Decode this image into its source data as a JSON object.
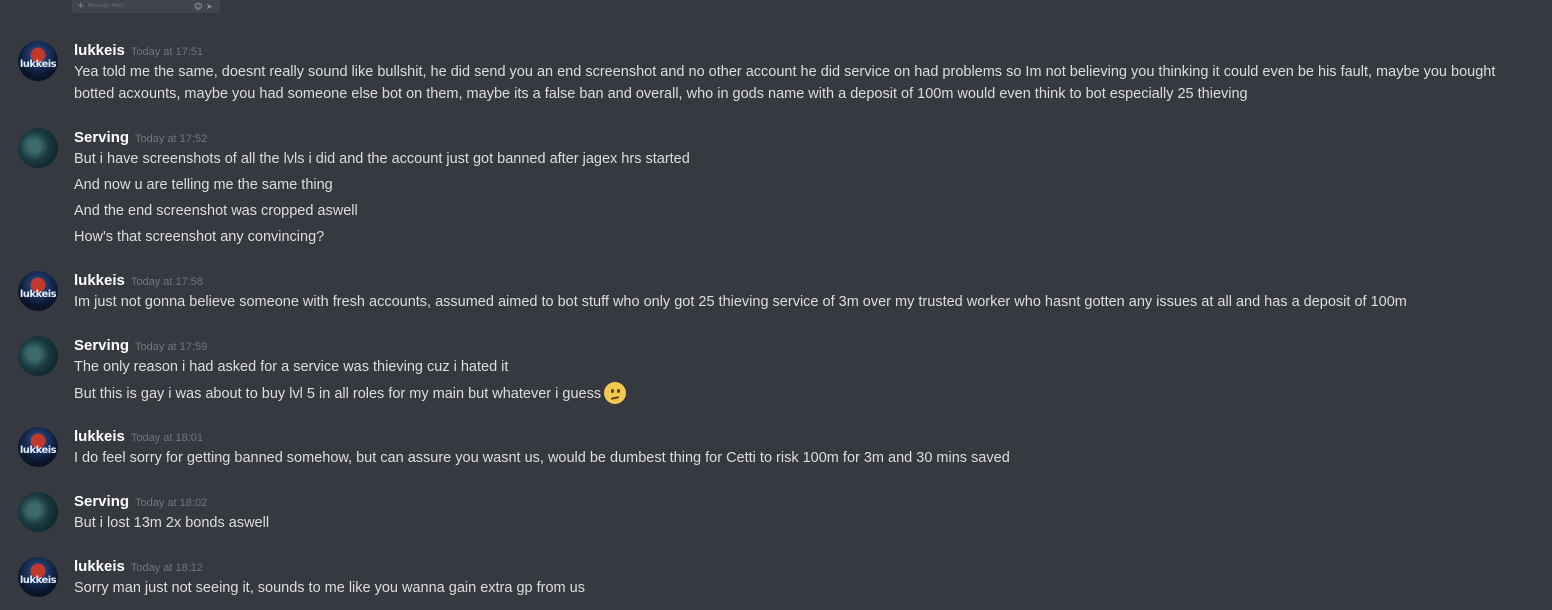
{
  "composer": {
    "placeholder": "Message #bill",
    "plus_icon": "+",
    "emoji_icon": "☺",
    "send_icon": "➤"
  },
  "messages": [
    {
      "author": "lukkeis",
      "avatar_text": "lukkeis",
      "timestamp": "Today at 17:51",
      "lines": [
        "Yea told me the same, doesnt really sound like bullshit, he did send you an end screenshot and no other account he did service on had problems so Im not believing you thinking it could even be his fault, maybe you bought",
        "botted acxounts, maybe you had someone else bot on them, maybe its a false ban and overall, who in gods name with a deposit of 100m would even think to bot especially 25 thieving"
      ]
    },
    {
      "author": "Serving",
      "timestamp": "Today at 17:52",
      "lines": [
        "But i have screenshots of all the lvls i did and the account just got banned after jagex hrs started",
        "And now u are telling me the same thing",
        "And the end screenshot was cropped aswell",
        "How's that screenshot any convincing?"
      ]
    },
    {
      "author": "lukkeis",
      "avatar_text": "lukkeis",
      "timestamp": "Today at 17:58",
      "lines": [
        "Im just not gonna believe someone with fresh accounts, assumed aimed to bot stuff who only got 25 thieving service of 3m over my trusted worker who hasnt gotten any issues at all and has a deposit of 100m"
      ]
    },
    {
      "author": "Serving",
      "timestamp": "Today at 17:59",
      "lines": [
        "The only reason i had asked for a service was thieving cuz i hated it",
        "But this is gay i was about to buy lvl 5 in all roles for my main but whatever i guess"
      ],
      "emoji": "confused-face"
    },
    {
      "author": "lukkeis",
      "avatar_text": "lukkeis",
      "timestamp": "Today at 18:01",
      "lines": [
        "I do feel sorry for getting banned somehow, but can assure you wasnt us, would be dumbest thing for Cetti to risk 100m for 3m and 30 mins saved"
      ]
    },
    {
      "author": "Serving",
      "timestamp": "Today at 18:02",
      "lines": [
        "But i lost 13m 2x bonds aswell"
      ]
    },
    {
      "author": "lukkeis",
      "avatar_text": "lukkeis",
      "timestamp": "Today at 18:12",
      "lines": [
        "Sorry man just not seeing it, sounds to me like you wanna gain extra gp from us"
      ]
    }
  ]
}
